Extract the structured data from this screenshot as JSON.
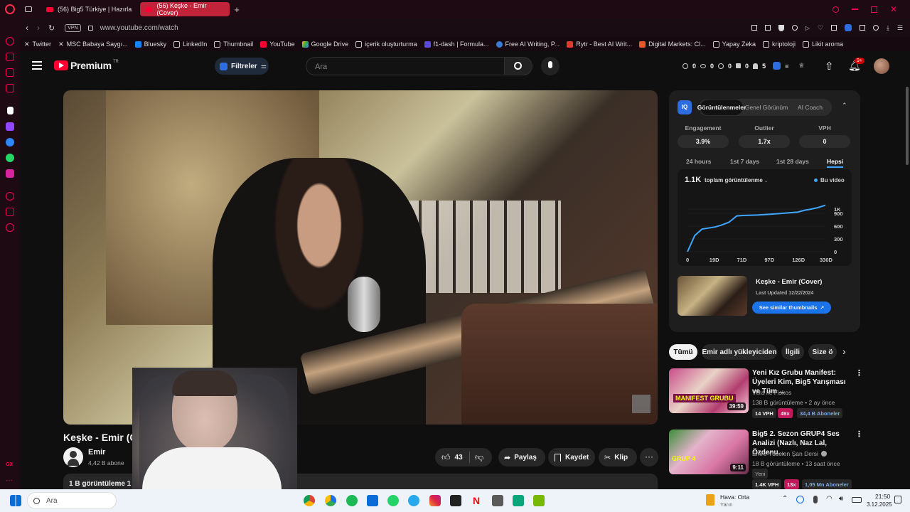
{
  "browser": {
    "tabs": [
      {
        "label": "(56) Big5 Türkiye | Hazırla"
      },
      {
        "label": "(56) Keşke - Emir (Cover)"
      }
    ],
    "new_tab": "+",
    "vpn": "VPN",
    "url": "www.youtube.com/watch"
  },
  "bookmarks": [
    {
      "label": "Twitter",
      "icon": "x-icon"
    },
    {
      "label": "MSC Babaya Saygı...",
      "icon": "x-icon"
    },
    {
      "label": "Bluesky",
      "icon": "bluesky-icon"
    },
    {
      "label": "LinkedIn",
      "icon": "folder-icon"
    },
    {
      "label": "Thumbnail",
      "icon": "folder-icon"
    },
    {
      "label": "YouTube",
      "icon": "youtube-icon"
    },
    {
      "label": "Google Drive",
      "icon": "drive-icon"
    },
    {
      "label": "içerik oluşturturma",
      "icon": "folder-icon"
    },
    {
      "label": "f1-dash | Formula...",
      "icon": "f1-icon"
    },
    {
      "label": "Free AI Writing, P...",
      "icon": "globe-icon"
    },
    {
      "label": "Rytr - Best AI Writ...",
      "icon": "rytr-icon"
    },
    {
      "label": "Digital Markets: Cl...",
      "icon": "dm-icon"
    },
    {
      "label": "Yapay Zeka",
      "icon": "folder-icon"
    },
    {
      "label": "kriptoloji",
      "icon": "folder-icon"
    },
    {
      "label": "Likit aroma",
      "icon": "folder-icon"
    }
  ],
  "youtube": {
    "logo": "Premium",
    "logo_sup": "TR",
    "filters_label": "Filtreler",
    "search_placeholder": "Ara",
    "stats_counters": [
      "0",
      "0",
      "0",
      "0",
      "5"
    ],
    "notif_badge": "9+"
  },
  "video": {
    "title": "Keşke - Emir (Cover)",
    "channel": "Emir",
    "subscribers": "4,42 B abone",
    "likes": "43",
    "share_label": "Paylaş",
    "save_label": "Kaydet",
    "clip_label": "Klip",
    "views_label": "1 B görüntüleme  1"
  },
  "vidiq": {
    "tabs": [
      "Görüntülenmeler",
      "Genel Görünüm",
      "AI Coach"
    ],
    "metrics": [
      {
        "label": "Engagement",
        "value": "3.9%"
      },
      {
        "label": "Outlier",
        "value": "1.7x"
      },
      {
        "label": "VPH",
        "value": "0"
      }
    ],
    "ranges": [
      "24 hours",
      "1st 7 days",
      "1st 28 days",
      "Hepsi"
    ],
    "total_views": "1.1K",
    "total_label": "toplam görüntülenme",
    "legend": "Bu video",
    "thumb_title": "Keşke - Emir (Cover)",
    "last_updated": "Last Updated 12/22/2024",
    "similar_btn": "See similar thumbnails",
    "accent": "#3ea6ff"
  },
  "chart_data": {
    "type": "line",
    "x": [
      0,
      5,
      10,
      19,
      30,
      45,
      60,
      71,
      85,
      97,
      110,
      126,
      150,
      180,
      210,
      240,
      270,
      300,
      330
    ],
    "values": [
      0,
      380,
      530,
      580,
      620,
      690,
      840,
      850,
      860,
      880,
      900,
      930,
      950,
      975,
      990,
      1010,
      1030,
      1060,
      1090
    ],
    "xticks": [
      "0",
      "19D",
      "71D",
      "97D",
      "126D",
      "330D"
    ],
    "yticks": [
      "0",
      "300",
      "600",
      "900",
      "1K"
    ],
    "ylim": [
      0,
      1200
    ],
    "xlim": [
      0,
      330
    ],
    "series_name": "Bu video"
  },
  "chips": [
    "Tümü",
    "Emir adlı yükleyiciden",
    "İlgili",
    "Size ö"
  ],
  "recommendations": [
    {
      "title": "Yeni Kız Grubu Manifest: Üyeleri Kim, Big5 Yarışması ve Tüm ...",
      "channel": "Vera ile Fiskos",
      "meta": "138 B görüntüleme • 2 ay önce",
      "duration": "39:59",
      "vph": "14 VPH",
      "mult": "49x",
      "subs": "34,4 B Aboneler",
      "badge": "",
      "thumb_text": "MANIFEST GRUBU"
    },
    {
      "title": "Big5 2. Sezon GRUP4 Ses Analizi (Nazlı, Naz Lal, Özdenu...",
      "channel": "Emre Yücelen Şan Dersi",
      "meta": "18 B görüntüleme • 13 saat önce",
      "duration": "9:11",
      "vph": "1.4K VPH",
      "mult": "13x",
      "subs": "1,05 Mn Aboneler",
      "badge": "Yeni",
      "thumb_text": "GRUP 4"
    }
  ],
  "taskbar": {
    "search": "Ara",
    "weather": "Hava: Orta",
    "weather_sub": "Yarın",
    "time": "21:50",
    "date": "3.12.2025"
  }
}
